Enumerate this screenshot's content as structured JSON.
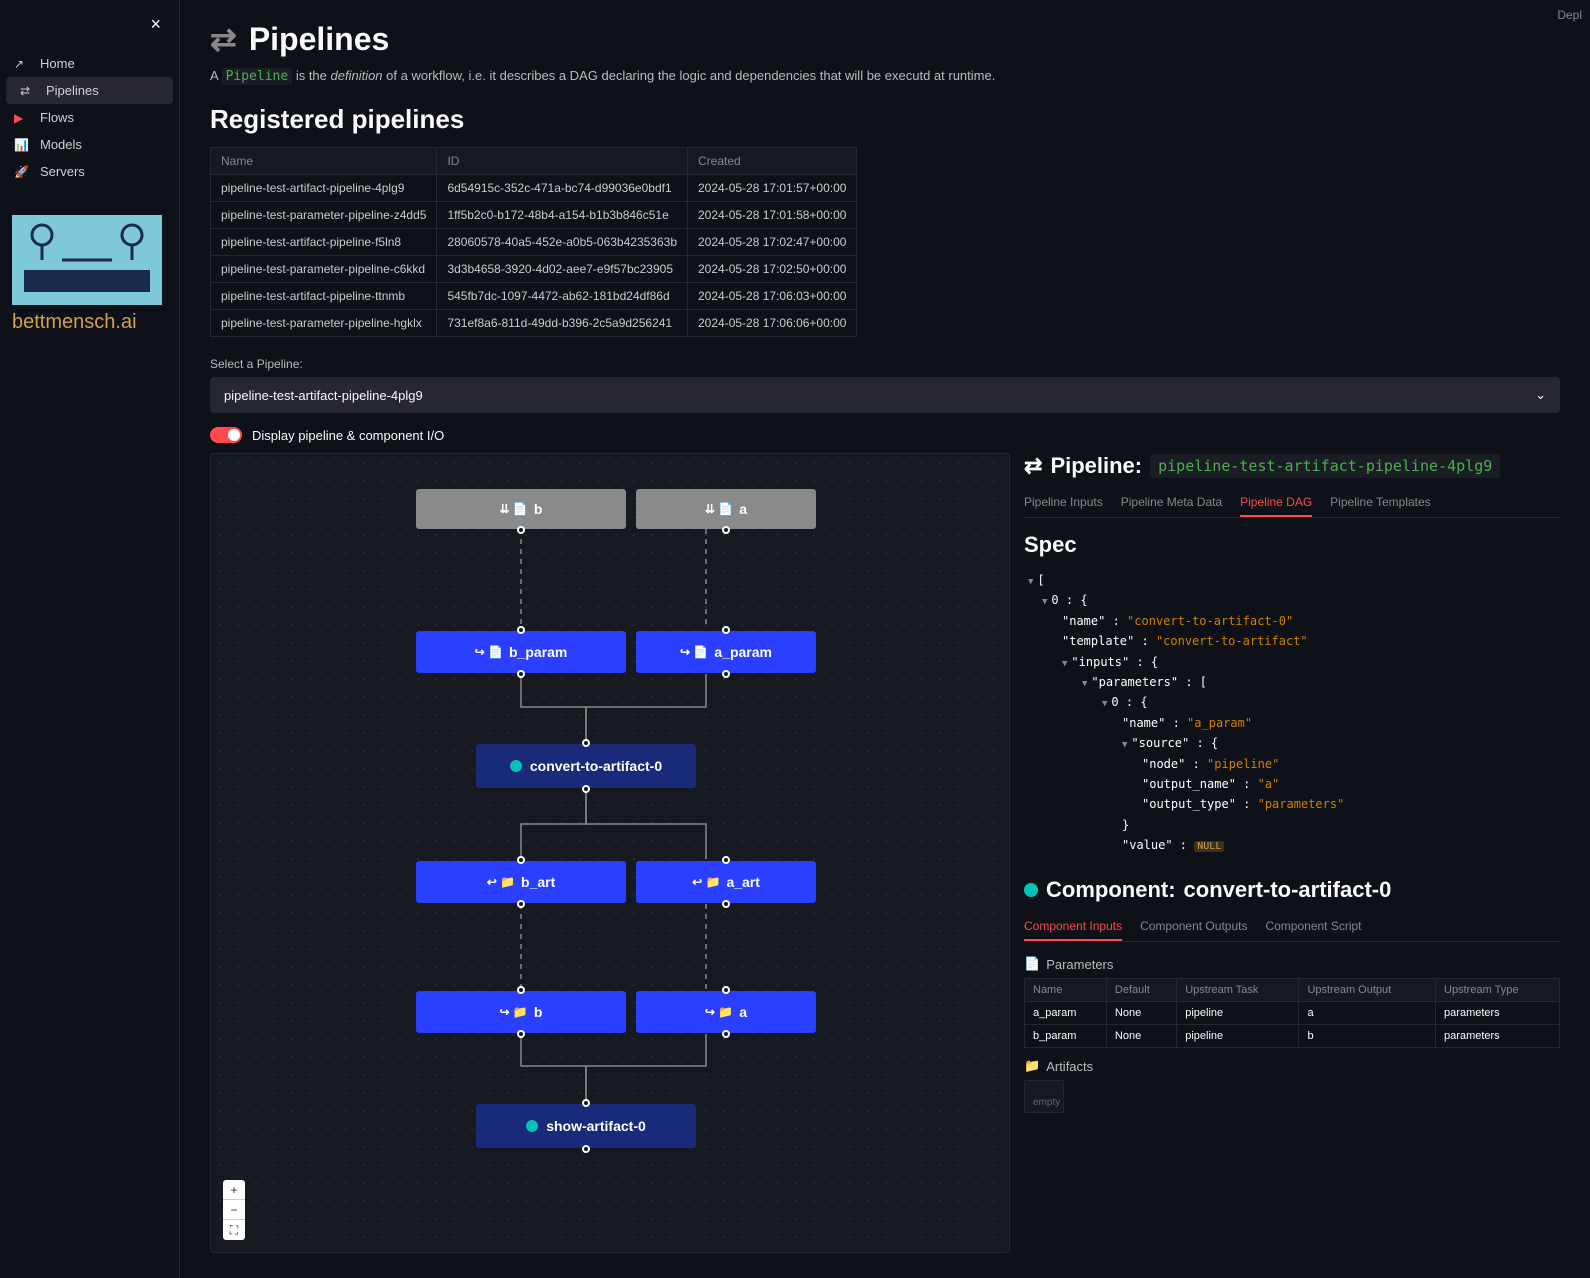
{
  "topRight": "Depl",
  "sidebar": {
    "items": [
      {
        "icon": "↗",
        "label": "Home"
      },
      {
        "icon": "⇄",
        "label": "Pipelines"
      },
      {
        "icon": "▶",
        "label": "Flows"
      },
      {
        "icon": "📊",
        "label": "Models"
      },
      {
        "icon": "🚀",
        "label": "Servers"
      }
    ],
    "brand": "bettmensch.ai"
  },
  "page": {
    "title": "Pipelines",
    "desc_pre": "A ",
    "desc_code": "Pipeline",
    "desc_mid": " is the ",
    "desc_em": "definition",
    "desc_post": " of a workflow, i.e. it describes a DAG declaring the logic and dependencies that will be executd at runtime."
  },
  "registered": {
    "heading": "Registered pipelines",
    "cols": [
      "Name",
      "ID",
      "Created"
    ],
    "rows": [
      [
        "pipeline-test-artifact-pipeline-4plg9",
        "6d54915c-352c-471a-bc74-d99036e0bdf1",
        "2024-05-28 17:01:57+00:00"
      ],
      [
        "pipeline-test-parameter-pipeline-z4dd5",
        "1ff5b2c0-b172-48b4-a154-b1b3b846c51e",
        "2024-05-28 17:01:58+00:00"
      ],
      [
        "pipeline-test-artifact-pipeline-f5ln8",
        "28060578-40a5-452e-a0b5-063b4235363b",
        "2024-05-28 17:02:47+00:00"
      ],
      [
        "pipeline-test-parameter-pipeline-c6kkd",
        "3d3b4658-3920-4d02-aee7-e9f57bc23905",
        "2024-05-28 17:02:50+00:00"
      ],
      [
        "pipeline-test-artifact-pipeline-ttnmb",
        "545fb7dc-1097-4472-ab62-181bd24df86d",
        "2024-05-28 17:06:03+00:00"
      ],
      [
        "pipeline-test-parameter-pipeline-hgklx",
        "731ef8a6-811d-49dd-b396-2c5a9d256241",
        "2024-05-28 17:06:06+00:00"
      ]
    ]
  },
  "selector": {
    "label": "Select a Pipeline:",
    "value": "pipeline-test-artifact-pipeline-4plg9"
  },
  "toggle": {
    "label": "Display pipeline & component I/O"
  },
  "dag": {
    "nodes": {
      "b_in": "b",
      "a_in": "a",
      "b_param": "b_param",
      "a_param": "a_param",
      "convert": "convert-to-artifact-0",
      "b_art": "b_art",
      "a_art": "a_art",
      "b_out": "b",
      "a_out": "a",
      "show": "show-artifact-0"
    }
  },
  "details": {
    "pipeline_label": "Pipeline:",
    "pipeline_name": "pipeline-test-artifact-pipeline-4plg9",
    "tabs": [
      "Pipeline Inputs",
      "Pipeline Meta Data",
      "Pipeline DAG",
      "Pipeline Templates"
    ],
    "spec_heading": "Spec",
    "spec": {
      "idx": "0",
      "name_key": "\"name\"",
      "name_val": "\"convert-to-artifact-0\"",
      "tmpl_key": "\"template\"",
      "tmpl_val": "\"convert-to-artifact\"",
      "inputs_key": "\"inputs\"",
      "params_key": "\"parameters\"",
      "p_idx": "0",
      "p_name_key": "\"name\"",
      "p_name_val": "\"a_param\"",
      "src_key": "\"source\"",
      "node_key": "\"node\"",
      "node_val": "\"pipeline\"",
      "outn_key": "\"output_name\"",
      "outn_val": "\"a\"",
      "outt_key": "\"output_type\"",
      "outt_val": "\"parameters\"",
      "val_key": "\"value\"",
      "val_val": "NULL"
    },
    "component_label": "Component:",
    "component_name": "convert-to-artifact-0",
    "ctabs": [
      "Component Inputs",
      "Component Outputs",
      "Component Script"
    ],
    "params_heading": "Parameters",
    "params_cols": [
      "Name",
      "Default",
      "Upstream Task",
      "Upstream Output",
      "Upstream Type"
    ],
    "params_rows": [
      [
        "a_param",
        "None",
        "pipeline",
        "a",
        "parameters"
      ],
      [
        "b_param",
        "None",
        "pipeline",
        "b",
        "parameters"
      ]
    ],
    "artifacts_heading": "Artifacts",
    "empty": "empty"
  }
}
